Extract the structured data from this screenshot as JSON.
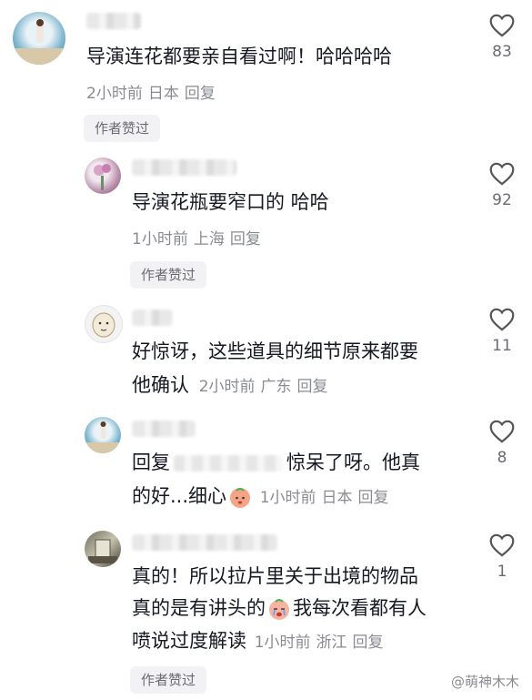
{
  "comments": [
    {
      "text": "导演连花都要亲自看过啊！哈哈哈哈",
      "time": "2小时前",
      "location": "日本",
      "reply": "回复",
      "author_liked": "作者赞过",
      "likes": "83"
    },
    {
      "text": "导演花瓶要窄口的 哈哈",
      "time": "1小时前",
      "location": "上海",
      "reply": "回复",
      "author_liked": "作者赞过",
      "likes": "92"
    },
    {
      "line1": "好惊讶，这些道具的细节原来都要",
      "line2": "他确认",
      "time": "2小时前",
      "location": "广东",
      "reply": "回复",
      "likes": "11"
    },
    {
      "prefix": "回复",
      "suffix": "惊呆了呀。他真",
      "line2": "的好...细心",
      "time": "1小时前",
      "location": "日本",
      "reply": "回复",
      "likes": "8"
    },
    {
      "line1": "真的！所以拉片里关于出境的物品",
      "line2a": "真的是有讲头的",
      "line2b": "我每次看都有人",
      "line3": "喷说过度解读",
      "time": "1小时前",
      "location": "浙江",
      "reply": "回复",
      "author_liked": "作者赞过",
      "likes": "1"
    }
  ],
  "watermark": "@萌神木木"
}
